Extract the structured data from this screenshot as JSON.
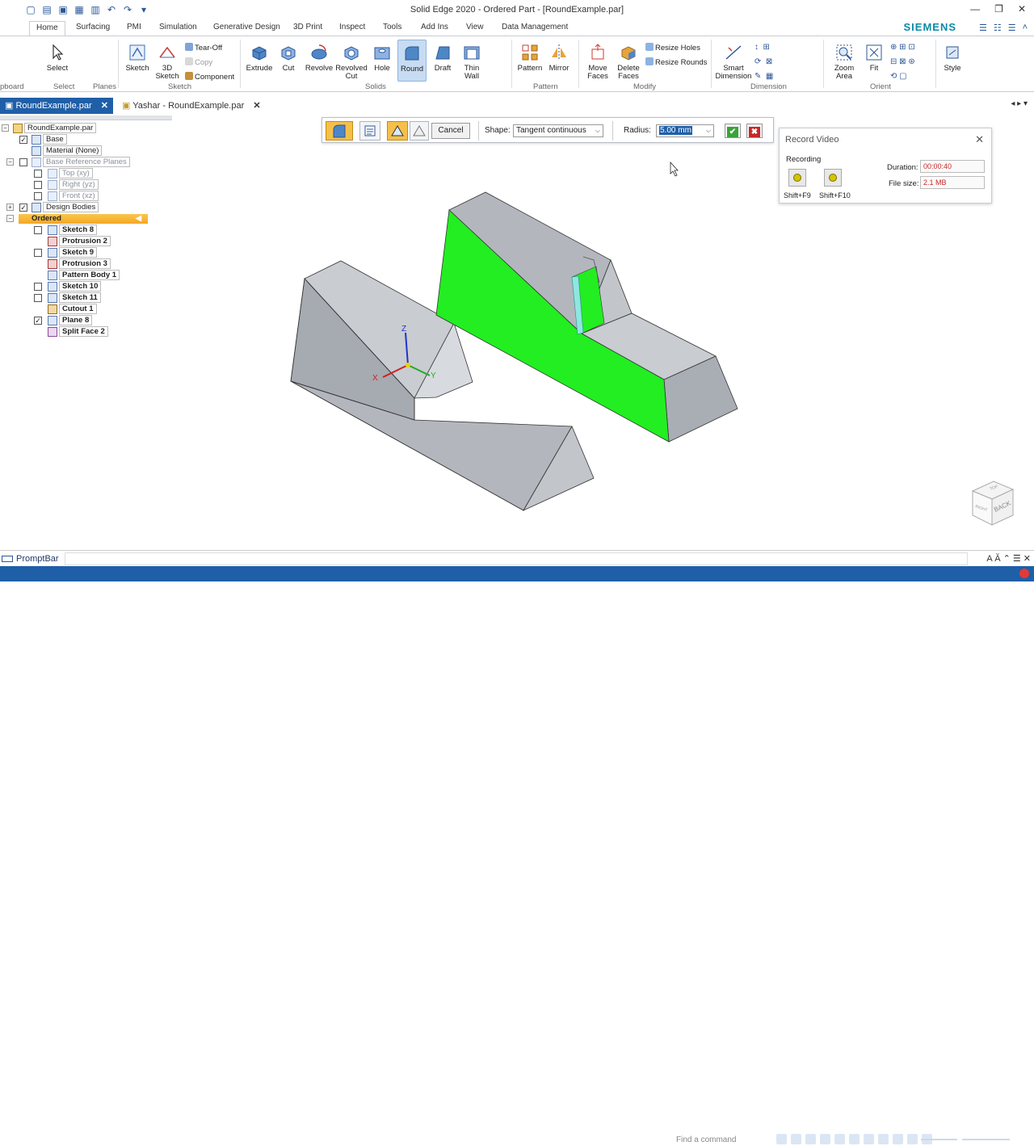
{
  "app": {
    "title": "Solid Edge 2020 - Ordered Part - [RoundExample.par]",
    "brand": "SIEMENS"
  },
  "ribbon_tabs": [
    "Home",
    "Surfacing",
    "PMI",
    "Simulation",
    "Generative Design",
    "3D Print",
    "Inspect",
    "Tools",
    "Add Ins",
    "View",
    "Data Management"
  ],
  "ribbon": {
    "clipboard_group": "pboard",
    "select_group": "Select",
    "select": "Select",
    "planes_group": "Planes",
    "sketch": "Sketch",
    "sketch3d": "3D Sketch",
    "tear_off": "Tear-Off",
    "copy": "Copy",
    "component": "Component",
    "sketch_group": "Sketch",
    "extrude": "Extrude",
    "cut": "Cut",
    "revolve": "Revolve",
    "revolved_cut": "Revolved Cut",
    "hole": "Hole",
    "round": "Round",
    "draft": "Draft",
    "thin_wall": "Thin Wall",
    "solids_group": "Solids",
    "pattern": "Pattern",
    "mirror": "Mirror",
    "pattern_group": "Pattern",
    "move_faces": "Move Faces",
    "delete_faces": "Delete Faces",
    "resize_holes": "Resize Holes",
    "resize_rounds": "Resize Rounds",
    "modify_group": "Modify",
    "smart_dimension": "Smart Dimension",
    "dimension_group": "Dimension",
    "zoom_area": "Zoom Area",
    "fit": "Fit",
    "orient_group": "Orient",
    "style": "Style"
  },
  "doc_tabs": [
    {
      "label": "RoundExample.par",
      "active": true
    },
    {
      "label": "Yashar - RoundExample.par",
      "active": false
    }
  ],
  "tree": {
    "root": "RoundExample.par",
    "base": "Base",
    "material": "Material (None)",
    "base_planes": "Base Reference Planes",
    "top": "Top (xy)",
    "right": "Right (yz)",
    "front": "Front (xz)",
    "design_bodies": "Design Bodies",
    "ordered": "Ordered",
    "sketch8": "Sketch 8",
    "protrusion2": "Protrusion 2",
    "sketch9": "Sketch 9",
    "protrusion3": "Protrusion 3",
    "pattern_body1": "Pattern Body 1",
    "sketch10": "Sketch 10",
    "sketch11": "Sketch 11",
    "cutout1": "Cutout 1",
    "plane8": "Plane 8",
    "split_face2": "Split Face 2"
  },
  "command_bar": {
    "cancel": "Cancel",
    "shape_label": "Shape:",
    "shape_value": "Tangent continuous",
    "radius_label": "Radius:",
    "radius_value": "5.00 mm"
  },
  "record_video": {
    "title": "Record Video",
    "status": "Recording",
    "pause_key": "Shift+F9",
    "stop_key": "Shift+F10",
    "duration_label": "Duration:",
    "duration_value": "00:00:40",
    "filesize_label": "File size:",
    "filesize_value": "2.1 MB"
  },
  "viewport": {
    "axis_z": "Z",
    "axis_x": "X",
    "axis_y": "Y",
    "cube_back": "BACK",
    "cube_right": "RIGHT",
    "cube_top": "TOP",
    "highlight_color": "#22ee22",
    "body_color": "#a9adb4"
  },
  "prompt_bar": {
    "label": "PromptBar"
  },
  "status_bar": {
    "find_placeholder": "Find a command"
  },
  "colors": {
    "accent": "#1f5fa8",
    "ordered": "#f5a623"
  }
}
